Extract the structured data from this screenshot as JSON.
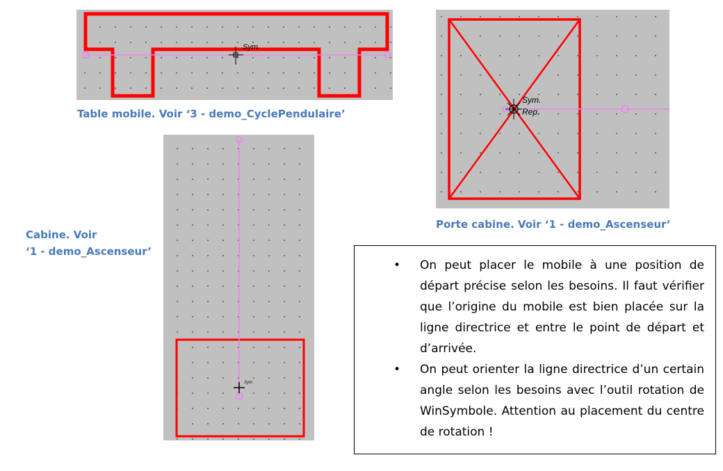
{
  "panels": {
    "table": {
      "caption": "Table mobile. Voir ‘3 - demo_CyclePendulaire’",
      "sym_label": "Sym."
    },
    "porte": {
      "caption": "Porte cabine. Voir ‘1 - demo_Ascenseur’",
      "sym_label": "Sym.",
      "rep_label": "Rep."
    },
    "cabine": {
      "caption_line1": "Cabine. Voir",
      "caption_line2": "‘1 - demo_Ascenseur’",
      "sym_label": "Sym"
    }
  },
  "note": {
    "bullets": [
      "On peut placer le mobile à une position de départ précise selon les besoins. Il faut vérifier que l’origine du mobile est bien placée sur la ligne directrice et entre le point de départ et d’arrivée.",
      "On peut orienter la ligne directrice d’un certain angle selon les besoins avec l’outil rotation de WinSymbole. Attention au placement du centre de rotation !"
    ]
  },
  "colors": {
    "panel_bg": "#c0c0c0",
    "shape": "#ff0000",
    "guide_line": "#ee82ee",
    "caption": "#4a7ab5"
  }
}
